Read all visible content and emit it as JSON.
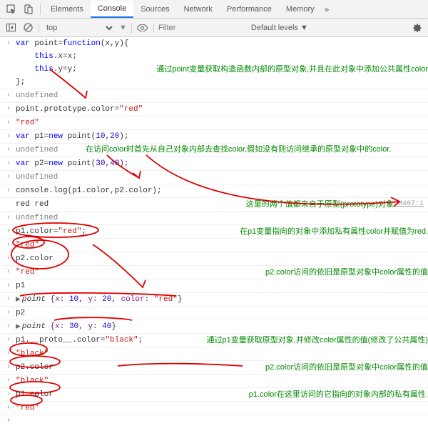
{
  "tabs": {
    "elements": "Elements",
    "console": "Console",
    "sources": "Sources",
    "network": "Network",
    "performance": "Performance",
    "memory": "Memory"
  },
  "toolbar": {
    "context": "top",
    "filter_placeholder": "Filter",
    "levels": "Default levels ▼"
  },
  "lines": {
    "l1a": "var point=function(x,y){",
    "l1b": "    this.x=x;",
    "l1c": "    this.y=y;",
    "l1d": "};",
    "l2": "undefined",
    "l3": "point.prototype.color=\"red\"",
    "l4": "\"red\"",
    "l5": "var p1=new point(10,20);",
    "l6": "undefined",
    "l7": "var p2=new point(30,40);",
    "l8": "undefined",
    "l9": "console.log(p1.color,p2.color);",
    "l10": "red red",
    "l11": "undefined",
    "l12": "p1.color=\"red\";",
    "l13": "\"red\"",
    "l14": "p2.color",
    "l15": "\"red\"",
    "l16": "p1",
    "l17": "point {x: 10, y: 20, color: \"red\"}",
    "l18": "p2",
    "l19": "point {x: 30, y: 40}",
    "l20": "p1.__proto__.color=\"black\";",
    "l21": "\"black\"",
    "l22": "p2.color",
    "l23": "\"black\"",
    "l24": "p1.color",
    "l25": "\"red\""
  },
  "comments": {
    "c1": "通过point变量获取构造函数内部的原型对象,并且在此对象中添加公共属性color",
    "c2": "在访问color时首先从自己对象内部去查找color,假如没有则访问继承的原型对象中的color.",
    "c3": "这里的两个值都来自于原型(prototype)对象",
    "c4": "在p1变量指向的对象中添加私有属性color并赋值为red.",
    "c5": "p2.color访问的依旧是原型对象中color属性的值",
    "c6": "通过p1变量获取原型对象,并修改color属性的值(修改了公共属性)",
    "c7": "p2.color访问的依旧是原型对象中color属性的值",
    "c8": "p1.color在这里访问的它指向的对象内部的私有属性."
  },
  "vm": "VM407:1"
}
